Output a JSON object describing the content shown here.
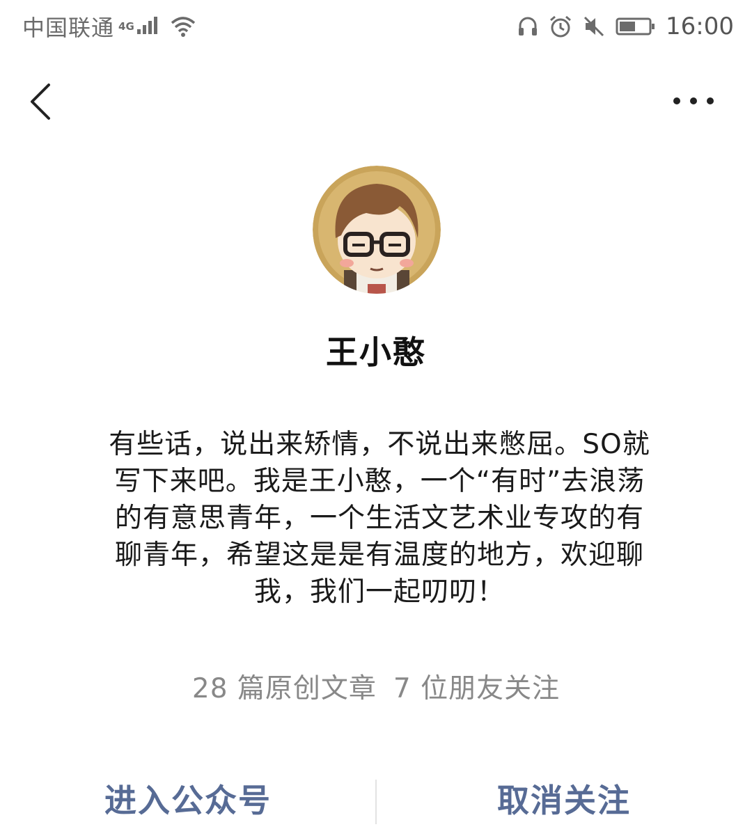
{
  "status_bar": {
    "carrier": "中国联通",
    "network_type": "4G",
    "time": "16:00",
    "icons": [
      "signal-icon",
      "wifi-icon",
      "headset-icon",
      "alarm-icon",
      "mute-icon",
      "battery-icon"
    ]
  },
  "nav": {
    "back_icon": "chevron-left-icon",
    "more_icon": "more-dots-icon"
  },
  "profile": {
    "name": "王小憨",
    "bio": "有些话，说出来矫情，不说出来憋屈。SO就写下来吧。我是王小憨，一个“有时”去浪荡的有意思青年，一个生活文艺术业专攻的有聊青年，希望这是是有温度的地方，欢迎聊我，我们一起叨叨！",
    "articles_stat": "28 篇原创文章",
    "friends_stat": "7 位朋友关注"
  },
  "actions": {
    "enter_label": "进入公众号",
    "unfollow_label": "取消关注"
  },
  "colors": {
    "link_blue": "#576b95",
    "muted_gray": "#888888",
    "text": "#1a1a1a"
  }
}
